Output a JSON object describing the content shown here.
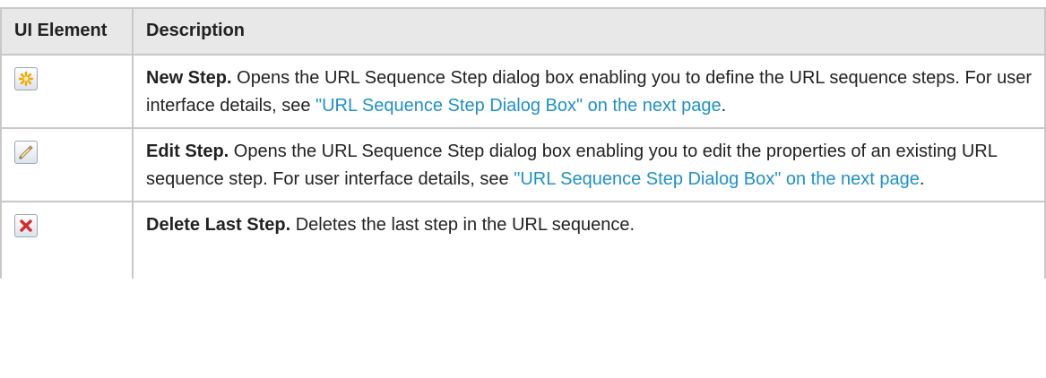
{
  "table": {
    "headers": {
      "ui_element": "UI Element",
      "description": "Description"
    },
    "rows": [
      {
        "icon": "new-step-icon",
        "title": "New Step.",
        "text": "Opens the URL Sequence Step dialog box enabling you to define the URL sequence steps. For user interface details, see",
        "link": "\"URL Sequence Step Dialog Box\" on the next page",
        "after": "."
      },
      {
        "icon": "edit-step-icon",
        "title": "Edit Step.",
        "text": "Opens the URL Sequence Step dialog box enabling you to edit the properties of an existing URL sequence step. For user interface details, see",
        "link": "\"URL Sequence Step Dialog Box\" on the next page",
        "after": "."
      },
      {
        "icon": "delete-step-icon",
        "title": "Delete Last Step.",
        "text": "Deletes the last step in the URL sequence.",
        "link": "",
        "after": ""
      }
    ]
  },
  "colors": {
    "link": "#1e90c8",
    "header_bg": "#e8e8e8",
    "border": "#c8c8c8"
  }
}
